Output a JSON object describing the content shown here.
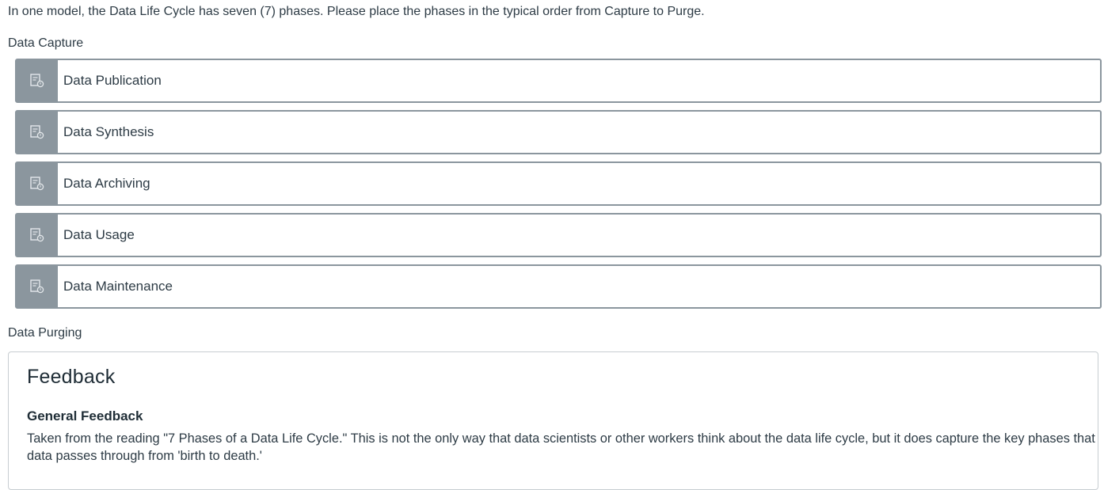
{
  "question": {
    "prompt": "In one model, the Data Life Cycle has seven (7) phases. Please place the phases in the typical order from Capture to Purge."
  },
  "ordering": {
    "top_anchor": "Data Capture",
    "bottom_anchor": "Data Purging",
    "handle_icon": "drag-handle-icon",
    "items": [
      {
        "label": "Data Publication"
      },
      {
        "label": "Data Synthesis"
      },
      {
        "label": "Data Archiving"
      },
      {
        "label": "Data Usage"
      },
      {
        "label": "Data Maintenance"
      }
    ]
  },
  "feedback": {
    "title": "Feedback",
    "subtitle": "General Feedback",
    "text": "Taken from the reading \"7 Phases of a Data Life Cycle.\" This is not the only way that data scientists or other workers think about the data life cycle, but it does capture the key phases that data passes through from 'birth to death.'"
  },
  "colors": {
    "handle_bg": "#8b969e",
    "item_border": "#8b969e",
    "text": "#2d3b45",
    "feedback_border": "#c7cdd1"
  }
}
